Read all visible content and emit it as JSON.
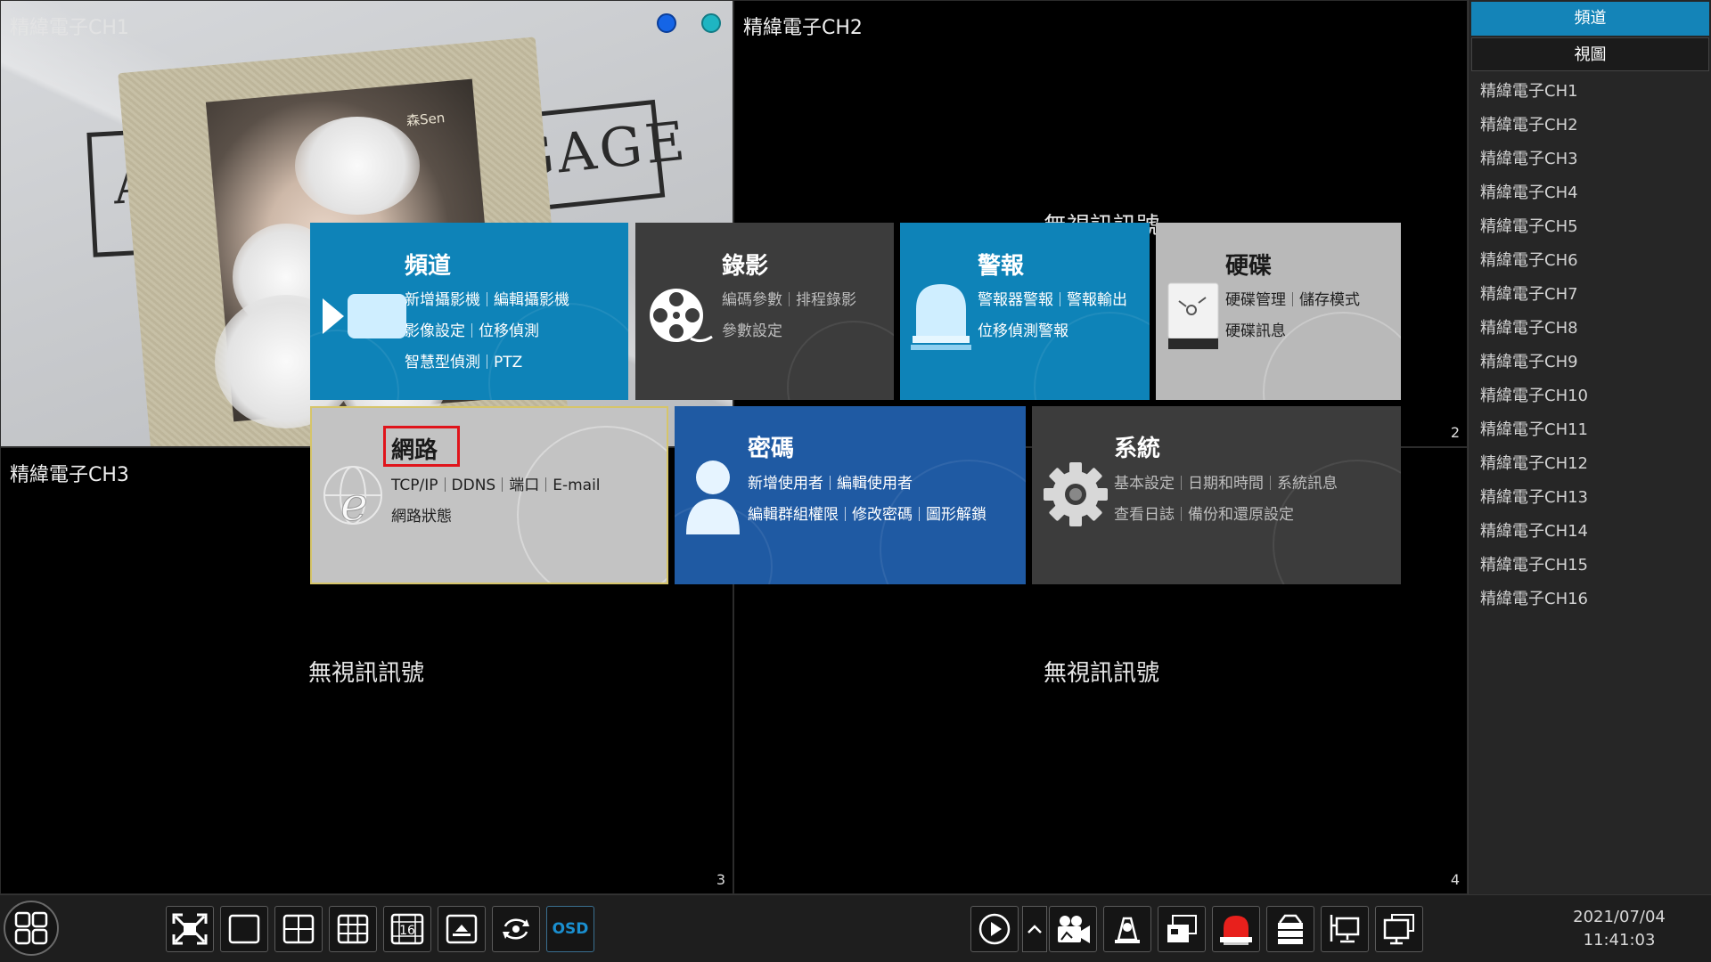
{
  "cameras": {
    "ch1": {
      "title": "精緯電子CH1"
    },
    "ch2": {
      "title": "精緯電子CH2",
      "num": "2",
      "no_signal_partial": "無視訊訊號"
    },
    "ch3": {
      "title": "精緯電子CH3",
      "num": "3",
      "no_signal": "無視訊訊號"
    },
    "ch4": {
      "num": "4",
      "no_signal": "無視訊訊號"
    }
  },
  "camera_scene": {
    "poster_letter_left": "A",
    "poster_text_right": "GAGE",
    "photo_mark": "森Sen"
  },
  "panel": {
    "tab_channel": "頻道",
    "tab_view": "視圖",
    "channels": [
      "精緯電子CH1",
      "精緯電子CH2",
      "精緯電子CH3",
      "精緯電子CH4",
      "精緯電子CH5",
      "精緯電子CH6",
      "精緯電子CH7",
      "精緯電子CH8",
      "精緯電子CH9",
      "精緯電子CH10",
      "精緯電子CH11",
      "精緯電子CH12",
      "精緯電子CH13",
      "精緯電子CH14",
      "精緯電子CH15",
      "精緯電子CH16"
    ]
  },
  "menu": {
    "channel": {
      "title": "頻道",
      "items": [
        "新增攝影機",
        "編輯攝影機",
        "影像設定",
        "位移偵測",
        "智慧型偵測",
        "PTZ"
      ]
    },
    "record": {
      "title": "錄影",
      "items": [
        "編碼參數",
        "排程錄影",
        "參數設定"
      ]
    },
    "alarm": {
      "title": "警報",
      "items": [
        "警報器警報",
        "警報輸出",
        "位移偵測警報"
      ]
    },
    "disk": {
      "title": "硬碟",
      "items": [
        "硬碟管理",
        "儲存模式",
        "硬碟訊息"
      ]
    },
    "network": {
      "title": "網路",
      "items": [
        "TCP/IP",
        "DDNS",
        "端口",
        "E-mail",
        "網路狀態"
      ]
    },
    "password": {
      "title": "密碼",
      "items": [
        "新增使用者",
        "編輯使用者",
        "編輯群組權限",
        "修改密碼",
        "圖形解鎖"
      ]
    },
    "system": {
      "title": "系統",
      "items": [
        "基本設定",
        "日期和時間",
        "系統訊息",
        "查看日誌",
        "備份和還原設定"
      ]
    }
  },
  "toolbar": {
    "osd_label": "OSD",
    "layout16_label": "16",
    "date": "2021/07/04",
    "time": "11:41:03"
  },
  "colors": {
    "accent_blue": "#0e83b8",
    "password_blue": "#1f5aa3",
    "highlight_red": "#e0141b",
    "alarm_red": "#e8201c"
  }
}
